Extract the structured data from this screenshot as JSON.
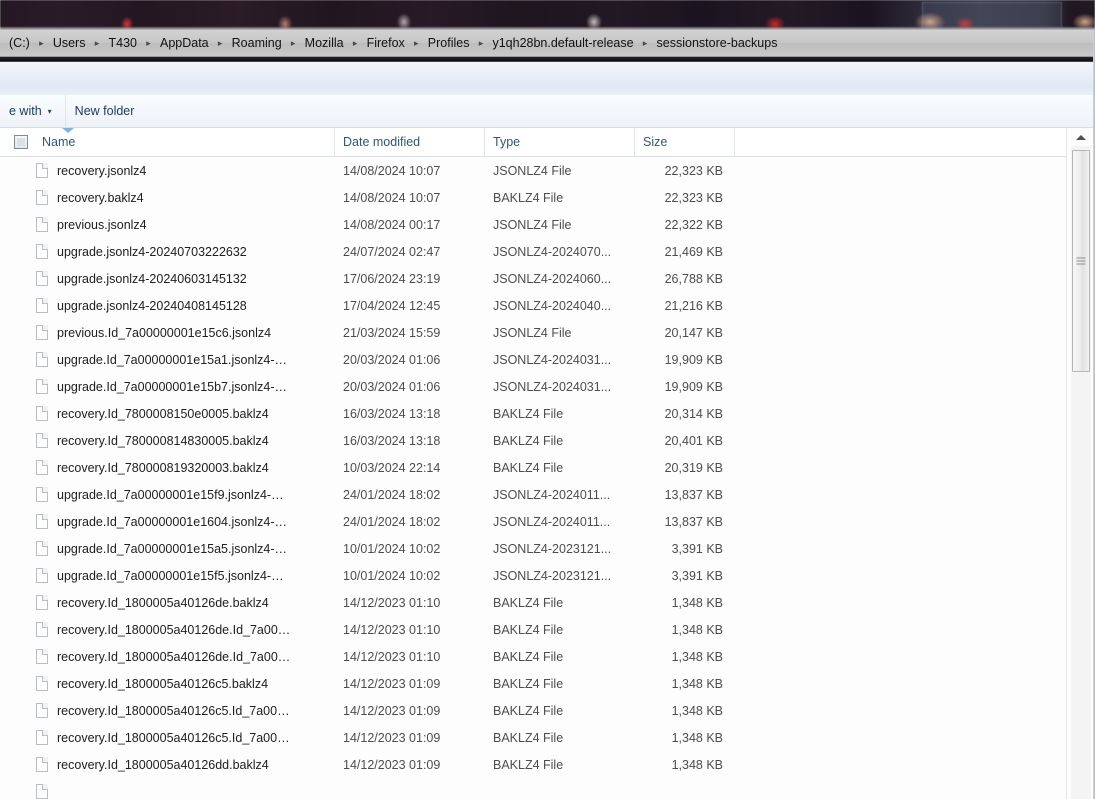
{
  "window": {
    "accent_color": "#2b587a",
    "sort_indicator_color": "#81b4de"
  },
  "address_bar": {
    "icon": "breadcrumb-separator-icon",
    "separator": "▸",
    "crumbs": [
      "(C:)",
      "Users",
      "T430",
      "AppData",
      "Roaming",
      "Mozilla",
      "Firefox",
      "Profiles",
      "y1qh28bn.default-release",
      "sessionstore-backups"
    ]
  },
  "toolbar": {
    "open_with_label": "e with",
    "open_with_caret": "▾",
    "new_folder_label": "New folder"
  },
  "columns": {
    "name": "Name",
    "date_modified": "Date modified",
    "type": "Type",
    "size": "Size",
    "sorted_by": "Date modified",
    "sort_direction": "descending"
  },
  "files": [
    {
      "name": "recovery.jsonlz4",
      "date": "14/08/2024 10:07",
      "type": "JSONLZ4 File",
      "size": "22,323 KB"
    },
    {
      "name": "recovery.baklz4",
      "date": "14/08/2024 10:07",
      "type": "BAKLZ4 File",
      "size": "22,323 KB"
    },
    {
      "name": "previous.jsonlz4",
      "date": "14/08/2024 00:17",
      "type": "JSONLZ4 File",
      "size": "22,322 KB"
    },
    {
      "name": "upgrade.jsonlz4-20240703222632",
      "date": "24/07/2024 02:47",
      "type": "JSONLZ4-2024070...",
      "size": "21,469 KB"
    },
    {
      "name": "upgrade.jsonlz4-20240603145132",
      "date": "17/06/2024 23:19",
      "type": "JSONLZ4-2024060...",
      "size": "26,788 KB"
    },
    {
      "name": "upgrade.jsonlz4-20240408145128",
      "date": "17/04/2024 12:45",
      "type": "JSONLZ4-2024040...",
      "size": "21,216 KB"
    },
    {
      "name": "previous.Id_7a00000001e15c6.jsonlz4",
      "date": "21/03/2024 15:59",
      "type": "JSONLZ4 File",
      "size": "20,147 KB"
    },
    {
      "name": "upgrade.Id_7a00000001e15a1.jsonlz4-…",
      "date": "20/03/2024 01:06",
      "type": "JSONLZ4-2024031...",
      "size": "19,909 KB"
    },
    {
      "name": "upgrade.Id_7a00000001e15b7.jsonlz4-…",
      "date": "20/03/2024 01:06",
      "type": "JSONLZ4-2024031...",
      "size": "19,909 KB"
    },
    {
      "name": "recovery.Id_7800008150e0005.baklz4",
      "date": "16/03/2024 13:18",
      "type": "BAKLZ4 File",
      "size": "20,314 KB"
    },
    {
      "name": "recovery.Id_780000814830005.baklz4",
      "date": "16/03/2024 13:18",
      "type": "BAKLZ4 File",
      "size": "20,401 KB"
    },
    {
      "name": "recovery.Id_780000819320003.baklz4",
      "date": "10/03/2024 22:14",
      "type": "BAKLZ4 File",
      "size": "20,319 KB"
    },
    {
      "name": "upgrade.Id_7a00000001e15f9.jsonlz4-…",
      "date": "24/01/2024 18:02",
      "type": "JSONLZ4-2024011...",
      "size": "13,837 KB"
    },
    {
      "name": "upgrade.Id_7a00000001e1604.jsonlz4-…",
      "date": "24/01/2024 18:02",
      "type": "JSONLZ4-2024011...",
      "size": "13,837 KB"
    },
    {
      "name": "upgrade.Id_7a00000001e15a5.jsonlz4-…",
      "date": "10/01/2024 10:02",
      "type": "JSONLZ4-2023121...",
      "size": "3,391 KB"
    },
    {
      "name": "upgrade.Id_7a00000001e15f5.jsonlz4-…",
      "date": "10/01/2024 10:02",
      "type": "JSONLZ4-2023121...",
      "size": "3,391 KB"
    },
    {
      "name": "recovery.Id_1800005a40126de.baklz4",
      "date": "14/12/2023 01:10",
      "type": "BAKLZ4 File",
      "size": "1,348 KB"
    },
    {
      "name": "recovery.Id_1800005a40126de.Id_7a00…",
      "date": "14/12/2023 01:10",
      "type": "BAKLZ4 File",
      "size": "1,348 KB"
    },
    {
      "name": "recovery.Id_1800005a40126de.Id_7a00…",
      "date": "14/12/2023 01:10",
      "type": "BAKLZ4 File",
      "size": "1,348 KB"
    },
    {
      "name": "recovery.Id_1800005a40126c5.baklz4",
      "date": "14/12/2023 01:09",
      "type": "BAKLZ4 File",
      "size": "1,348 KB"
    },
    {
      "name": "recovery.Id_1800005a40126c5.Id_7a00…",
      "date": "14/12/2023 01:09",
      "type": "BAKLZ4 File",
      "size": "1,348 KB"
    },
    {
      "name": "recovery.Id_1800005a40126c5.Id_7a00…",
      "date": "14/12/2023 01:09",
      "type": "BAKLZ4 File",
      "size": "1,348 KB"
    },
    {
      "name": "recovery.Id_1800005a40126dd.baklz4",
      "date": "14/12/2023 01:09",
      "type": "BAKLZ4 File",
      "size": "1,348 KB"
    }
  ],
  "scrollbar": {
    "up_arrow": "scroll-up-icon",
    "grip": "scroll-thumb-grip"
  }
}
